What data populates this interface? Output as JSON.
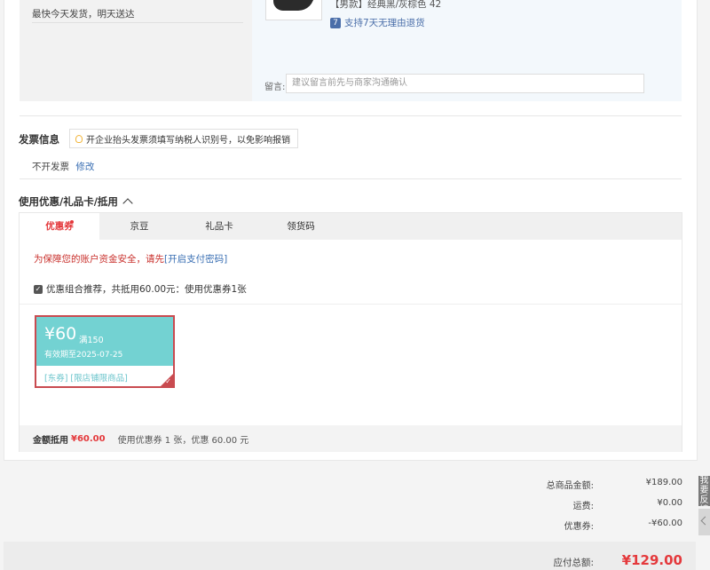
{
  "shipping": {
    "text": "最快今天发货，明天送达"
  },
  "product": {
    "variant": "【男款】经典黑/灰棕色 42",
    "return_icon": "7",
    "return_policy": "支持7天无理由退货",
    "message_label": "留言:",
    "message_placeholder": "建议留言前先与商家沟通确认"
  },
  "invoice": {
    "title": "发票信息",
    "tip": "开企业抬头发票须填写纳税人识别号，以免影响报销",
    "status": "不开发票",
    "edit_label": "修改"
  },
  "coupons": {
    "title": "使用优惠/礼品卡/抵用",
    "tabs": [
      {
        "label": "优惠券"
      },
      {
        "label": "京豆"
      },
      {
        "label": "礼品卡"
      },
      {
        "label": "领货码"
      }
    ],
    "security_text": "为保障您的账户资金安全，请先",
    "security_link": "[开启支付密码]",
    "combo_text": "优惠组合推荐，共抵用60.00元：使用优惠券1张",
    "coupon": {
      "amount": "¥60",
      "condition": "满150",
      "expiry": "有效期至2025-07-25",
      "tags": "[东券] [限店铺限商品]"
    },
    "summary_label": "金额抵用",
    "summary_value": "¥60.00",
    "summary_desc": "使用优惠券 1 张，优惠 60.00 元"
  },
  "totals": {
    "rows": [
      {
        "label": "总商品金额:",
        "value": "¥189.00"
      },
      {
        "label": "运费:",
        "value": "¥0.00"
      },
      {
        "label": "优惠券:",
        "value": "-¥60.00"
      }
    ],
    "payable_label": "应付总额:",
    "payable_value": "¥129.00"
  },
  "sidebar": {
    "feedback_label": "我要反馈"
  },
  "colors": {
    "accent_red": "#e4393c",
    "coupon_teal": "#73d2d2",
    "link_blue": "#3a6fb3"
  },
  "icons": {
    "return": "return-policy-icon",
    "tip": "lightbulb-icon",
    "collapse": "chevron-up-icon",
    "check": "checkbox-checked-icon",
    "top": "back-to-top-icon"
  }
}
